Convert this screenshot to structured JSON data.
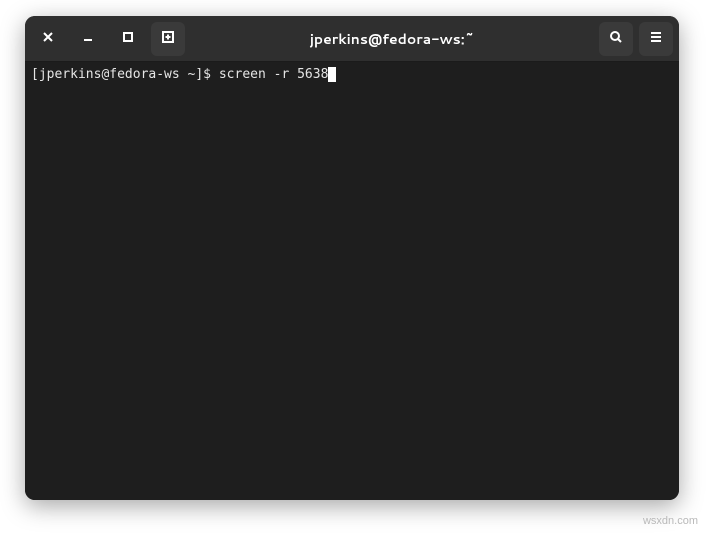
{
  "window": {
    "title": "jperkins@fedora-ws:~"
  },
  "titlebar": {
    "close_label": "Close",
    "minimize_label": "Minimize",
    "maximize_label": "Maximize",
    "newtab_label": "New Tab",
    "search_label": "Search",
    "menu_label": "Menu"
  },
  "terminal": {
    "prompt": "[jperkins@fedora-ws ~]$ ",
    "command": "screen -r 5638"
  },
  "watermark": "wsxdn.com"
}
